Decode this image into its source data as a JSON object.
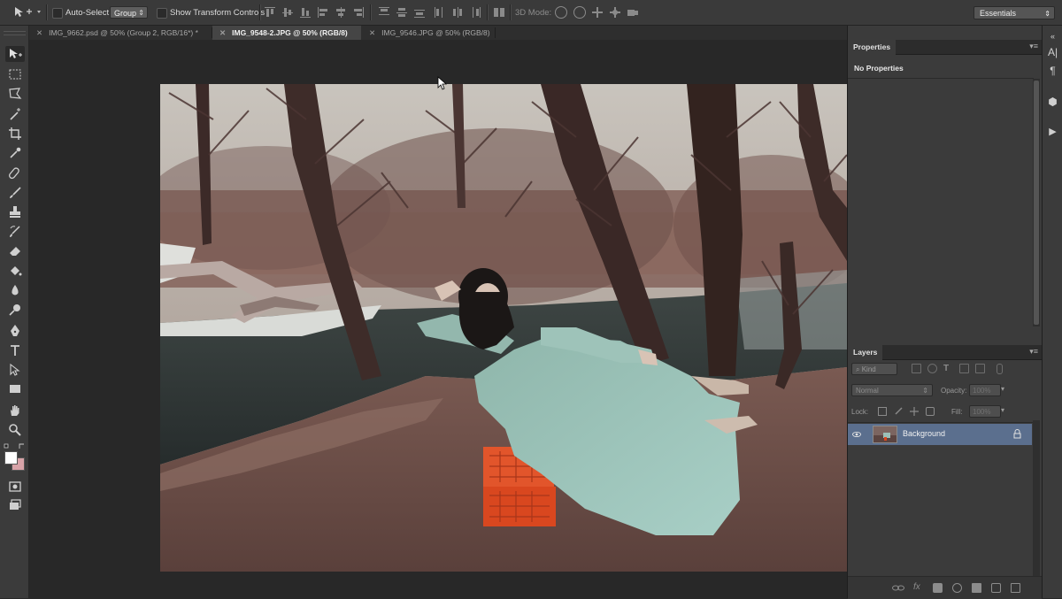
{
  "options_bar": {
    "auto_select_label": "Auto-Select:",
    "auto_select_value": "Group",
    "show_transform_label": "Show Transform Controls",
    "mode_3d_label": "3D Mode:",
    "workspace": "Essentials"
  },
  "tabs": [
    {
      "label": "IMG_9662.psd @ 50% (Group 2, RGB/16*) *",
      "active": false
    },
    {
      "label": "IMG_9548-2.JPG @ 50% (RGB/8)",
      "active": true
    },
    {
      "label": "IMG_9546.JPG @ 50% (RGB/8)",
      "active": false
    }
  ],
  "properties_panel": {
    "title": "Properties",
    "empty_text": "No Properties"
  },
  "layers_panel": {
    "title": "Layers",
    "filter_kind": "Kind",
    "blend_mode": "Normal",
    "opacity_label": "Opacity:",
    "opacity_value": "100%",
    "lock_label": "Lock:",
    "fill_label": "Fill:",
    "fill_value": "100%",
    "layers": [
      {
        "name": "Background",
        "visible": true,
        "locked": true
      }
    ],
    "footer_fx": "fx"
  },
  "dock": {
    "character_icon": "A|",
    "paragraph_icon": "¶"
  },
  "colors": {
    "foreground": "#ffffff",
    "background": "#d8a3a8",
    "selected_layer": "#5b6f8e"
  }
}
